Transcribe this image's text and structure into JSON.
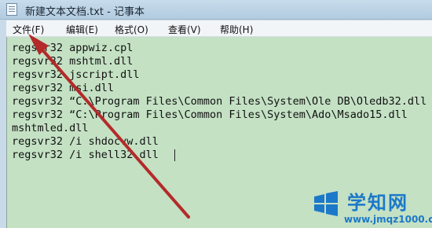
{
  "window": {
    "title": "新建文本文档.txt - 记事本"
  },
  "menu": [
    {
      "label": "文件(F)"
    },
    {
      "label": "编辑(E)"
    },
    {
      "label": "格式(O)"
    },
    {
      "label": "查看(V)"
    },
    {
      "label": "帮助(H)"
    }
  ],
  "editor": {
    "lines": [
      "regsvr32 appwiz.cpl",
      "regsvr32 mshtml.dll",
      "regsvr32 jscript.dll",
      "regsvr32 msi.dll",
      "regsvr32 “C:\\Program Files\\Common Files\\System\\Ole DB\\Oledb32.dll",
      "regsvr32 “C:\\Program Files\\Common Files\\System\\Ado\\Msado15.dll",
      "mshtmled.dll",
      "regsvr32 /i shdocvw.dll",
      "regsvr32 /i shell32.dll"
    ]
  },
  "annotation": {
    "arrow_color": "#b42a2a"
  },
  "watermark": {
    "title": "学知网",
    "url": "www.jmqz1000.com"
  }
}
